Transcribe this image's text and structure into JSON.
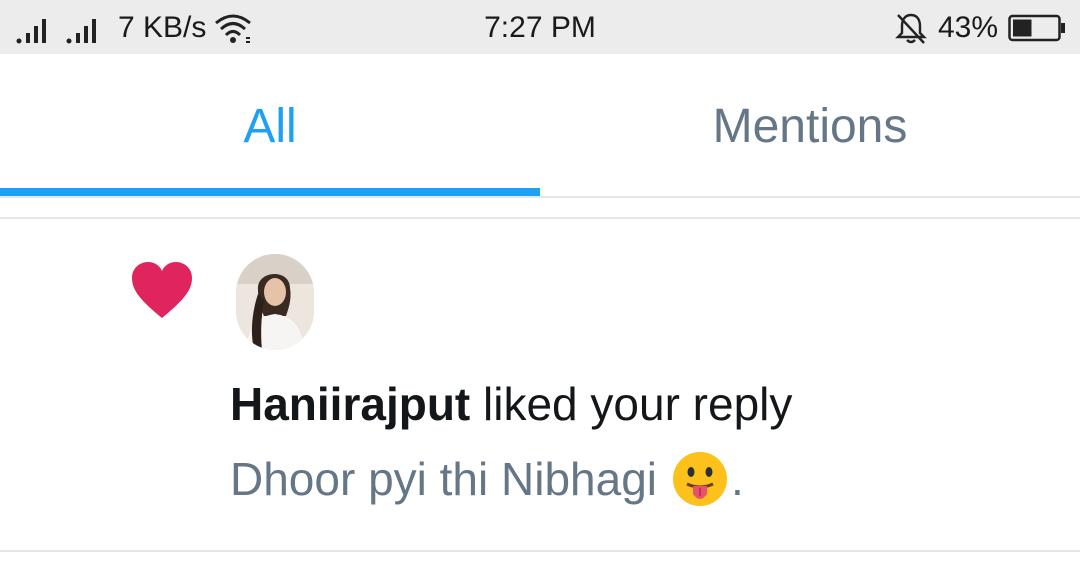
{
  "status_bar": {
    "signal_icon": "signal-bars-icon",
    "speed": "7 KB/s",
    "wifi_icon": "wifi-icon",
    "time": "7:27 PM",
    "silent_icon": "bell-off-icon",
    "battery_percent": "43%",
    "battery_level": 0.43,
    "battery_icon": "battery-icon"
  },
  "tabs": {
    "all": "All",
    "mentions": "Mentions",
    "active": "All",
    "active_color": "#1da1f2",
    "inactive_color": "#657786"
  },
  "notification": {
    "icon": "heart-icon",
    "icon_color": "#e0245e",
    "avatar": "avatar",
    "username": "Haniirajput",
    "action": " liked your reply",
    "tweet_text": "Dhoor pyi thi Nibhagi",
    "tweet_emoji": "face-with-tongue-icon",
    "tweet_suffix": "."
  }
}
